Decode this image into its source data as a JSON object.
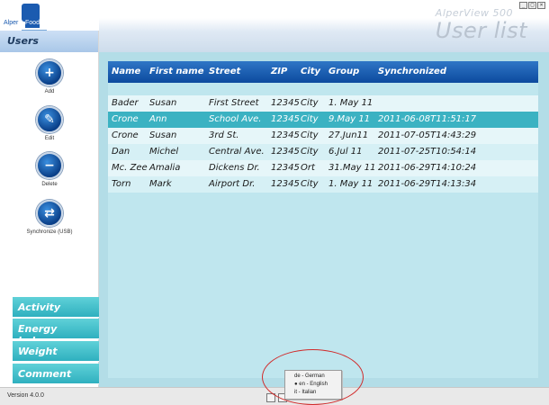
{
  "app": {
    "logo_text_1": "Alper",
    "logo_text_2": "Food",
    "title": "AlperView 500",
    "window_controls": [
      "_",
      "□",
      "×"
    ]
  },
  "page": {
    "title": "User list"
  },
  "sidebar": {
    "section": "Users",
    "actions": [
      {
        "label": "Add",
        "icon": "add-user-icon"
      },
      {
        "label": "Edit",
        "icon": "edit-user-icon"
      },
      {
        "label": "Delete",
        "icon": "delete-user-icon"
      },
      {
        "label": "Synchronize (USB)",
        "icon": "sync-usb-icon"
      }
    ],
    "nav": [
      "Activity",
      "Energy balance",
      "Weight",
      "Comment"
    ]
  },
  "table": {
    "headers": [
      "Name",
      "First name",
      "Street",
      "ZIP",
      "City",
      "Group",
      "Synchronized"
    ],
    "rows": [
      [
        "Bader",
        "Susan",
        "First Street",
        "12345",
        "City",
        "1. May 11",
        ""
      ],
      [
        "Crone",
        "Ann",
        "School Ave.",
        "12345",
        "City",
        "9.May 11",
        "2011-06-08T11:51:17"
      ],
      [
        "Crone",
        "Susan",
        "3rd St.",
        "12345",
        "City",
        "27.Jun11",
        "2011-07-05T14:43:29"
      ],
      [
        "Dan",
        "Michel",
        "Central Ave.",
        "12345",
        "City",
        "6.Jul 11",
        "2011-07-25T10:54:14"
      ],
      [
        "Mc. Zee",
        "Amalia",
        "Dickens Dr.",
        "12345",
        "Ort",
        "31.May 11",
        "2011-06-29T14:10:24"
      ],
      [
        "Torn",
        "Mark",
        "Airport Dr.",
        "12345",
        "City",
        "1. May 11",
        "2011-06-29T14:13:34"
      ]
    ],
    "selected_row": 1
  },
  "footer": {
    "version": "Version 4.0.0"
  },
  "language_menu": {
    "options": [
      "de - German",
      "en - English",
      "it - Italian"
    ],
    "selected": "en - English"
  },
  "colors": {
    "header_blue": "#0c4a9e",
    "selected_row": "#3bb2c2",
    "nav_teal": "#2fb0bf",
    "highlight_circle": "#d12a2a"
  }
}
